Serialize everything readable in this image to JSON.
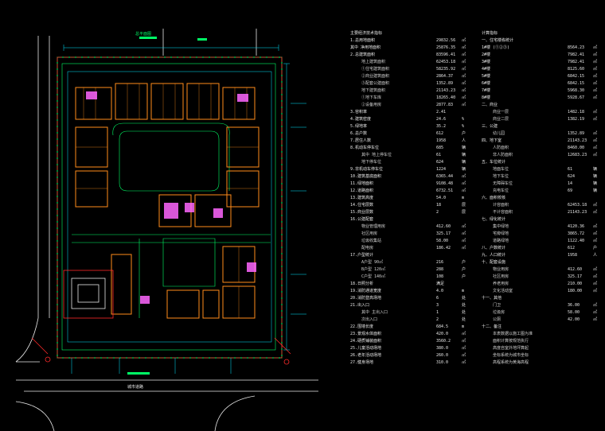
{
  "drawing": {
    "site_title": "总平面图",
    "road_label": "城市道路"
  },
  "tables": {
    "left": [
      {
        "label": "主要经济技术指标",
        "value": "",
        "unit": ""
      },
      {
        "label": "1.总用地面积",
        "value": "29832.56",
        "unit": "㎡"
      },
      {
        "label": "其中 净用地面积",
        "value": "25876.35",
        "unit": "㎡"
      },
      {
        "label": "2.总建筑面积",
        "value": "83596.41",
        "unit": "㎡"
      },
      {
        "label": "地上建筑面积",
        "value": "62453.18",
        "unit": "㎡",
        "sub": true
      },
      {
        "label": "①住宅建筑面积",
        "value": "58235.92",
        "unit": "㎡",
        "sub": true
      },
      {
        "label": "②商业建筑面积",
        "value": "2864.37",
        "unit": "㎡",
        "sub": true
      },
      {
        "label": "③配套公建面积",
        "value": "1352.89",
        "unit": "㎡",
        "sub": true
      },
      {
        "label": "地下建筑面积",
        "value": "21143.23",
        "unit": "㎡",
        "sub": true
      },
      {
        "label": "①地下车库",
        "value": "18265.40",
        "unit": "㎡",
        "sub": true
      },
      {
        "label": "②设备用房",
        "value": "2877.83",
        "unit": "㎡",
        "sub": true
      },
      {
        "label": "3.容积率",
        "value": "2.41",
        "unit": ""
      },
      {
        "label": "4.建筑密度",
        "value": "24.6",
        "unit": "%"
      },
      {
        "label": "5.绿地率",
        "value": "35.2",
        "unit": "%"
      },
      {
        "label": "6.总户数",
        "value": "612",
        "unit": "户"
      },
      {
        "label": "7.居住人数",
        "value": "1958",
        "unit": "人"
      },
      {
        "label": "8.机动车停车位",
        "value": "685",
        "unit": "辆"
      },
      {
        "label": "其中 地上停车位",
        "value": "61",
        "unit": "辆",
        "sub": true
      },
      {
        "label": "地下停车位",
        "value": "624",
        "unit": "辆",
        "sub": true
      },
      {
        "label": "9.非机动车停车位",
        "value": "1224",
        "unit": "辆"
      },
      {
        "label": "10.建筑基底面积",
        "value": "6365.44",
        "unit": "㎡"
      },
      {
        "label": "11.绿地面积",
        "value": "9108.48",
        "unit": "㎡"
      },
      {
        "label": "12.道路面积",
        "value": "6732.51",
        "unit": "㎡"
      },
      {
        "label": "13.建筑高度",
        "value": "54.0",
        "unit": "m"
      },
      {
        "label": "14.住宅层数",
        "value": "18",
        "unit": "层"
      },
      {
        "label": "15.商业层数",
        "value": "2",
        "unit": "层"
      },
      {
        "label": "16.公建配套",
        "value": "",
        "unit": ""
      },
      {
        "label": "物业管理用房",
        "value": "412.60",
        "unit": "㎡",
        "sub": true
      },
      {
        "label": "社区用房",
        "value": "325.17",
        "unit": "㎡",
        "sub": true
      },
      {
        "label": "垃圾收集站",
        "value": "58.00",
        "unit": "㎡",
        "sub": true
      },
      {
        "label": "配电房",
        "value": "186.42",
        "unit": "㎡",
        "sub": true
      },
      {
        "label": "17.户型统计",
        "value": "",
        "unit": ""
      },
      {
        "label": "A户型 90㎡",
        "value": "216",
        "unit": "户",
        "sub": true
      },
      {
        "label": "B户型 120㎡",
        "value": "288",
        "unit": "户",
        "sub": true
      },
      {
        "label": "C户型 140㎡",
        "value": "108",
        "unit": "户",
        "sub": true
      },
      {
        "label": "18.日照分析",
        "value": "满足",
        "unit": ""
      },
      {
        "label": "19.消防通道宽度",
        "value": "4.0",
        "unit": "m"
      },
      {
        "label": "20.消防登高场地",
        "value": "6",
        "unit": "处"
      },
      {
        "label": "21.出入口",
        "value": "3",
        "unit": "处"
      },
      {
        "label": "其中 主出入口",
        "value": "1",
        "unit": "处",
        "sub": true
      },
      {
        "label": "次出入口",
        "value": "2",
        "unit": "处",
        "sub": true
      },
      {
        "label": "22.围墙长度",
        "value": "684.5",
        "unit": "m"
      },
      {
        "label": "23.景观水体面积",
        "value": "420.0",
        "unit": "㎡"
      },
      {
        "label": "24.硬质铺装面积",
        "value": "3560.2",
        "unit": "㎡"
      },
      {
        "label": "25.儿童活动场地",
        "value": "380.0",
        "unit": "㎡"
      },
      {
        "label": "26.老年活动场地",
        "value": "260.0",
        "unit": "㎡"
      },
      {
        "label": "27.健身场地",
        "value": "310.0",
        "unit": "㎡"
      }
    ],
    "right": [
      {
        "label": "计算指标",
        "value": "",
        "unit": ""
      },
      {
        "label": "一、住宅楼栋统计",
        "value": "",
        "unit": ""
      },
      {
        "label": "1#楼 (①②③)",
        "value": "8564.23",
        "unit": "㎡"
      },
      {
        "label": "2#楼",
        "value": "7982.41",
        "unit": "㎡"
      },
      {
        "label": "3#楼",
        "value": "7982.41",
        "unit": "㎡"
      },
      {
        "label": "4#楼",
        "value": "8125.60",
        "unit": "㎡"
      },
      {
        "label": "5#楼",
        "value": "6842.15",
        "unit": "㎡"
      },
      {
        "label": "6#楼",
        "value": "6842.15",
        "unit": "㎡"
      },
      {
        "label": "7#楼",
        "value": "5968.30",
        "unit": "㎡"
      },
      {
        "label": "8#楼",
        "value": "5928.67",
        "unit": "㎡"
      },
      {
        "label": "二、商业",
        "value": "",
        "unit": ""
      },
      {
        "label": "商业一层",
        "value": "1482.18",
        "unit": "㎡",
        "sub": true
      },
      {
        "label": "商业二层",
        "value": "1382.19",
        "unit": "㎡",
        "sub": true
      },
      {
        "label": "三、公建",
        "value": "",
        "unit": ""
      },
      {
        "label": "幼儿园",
        "value": "1352.89",
        "unit": "㎡",
        "sub": true
      },
      {
        "label": "四、地下室",
        "value": "21143.23",
        "unit": "㎡"
      },
      {
        "label": "人防面积",
        "value": "8460.00",
        "unit": "㎡",
        "sub": true
      },
      {
        "label": "非人防面积",
        "value": "12683.23",
        "unit": "㎡",
        "sub": true
      },
      {
        "label": "五、车位统计",
        "value": "",
        "unit": ""
      },
      {
        "label": "地面车位",
        "value": "61",
        "unit": "辆",
        "sub": true
      },
      {
        "label": "地下车位",
        "value": "624",
        "unit": "辆",
        "sub": true
      },
      {
        "label": "无障碍车位",
        "value": "14",
        "unit": "辆",
        "sub": true
      },
      {
        "label": "充电车位",
        "value": "69",
        "unit": "辆",
        "sub": true
      },
      {
        "label": "六、面积校核",
        "value": "",
        "unit": ""
      },
      {
        "label": "计容面积",
        "value": "62453.18",
        "unit": "㎡",
        "sub": true
      },
      {
        "label": "不计容面积",
        "value": "21143.23",
        "unit": "㎡",
        "sub": true
      },
      {
        "label": "七、绿化统计",
        "value": "",
        "unit": ""
      },
      {
        "label": "集中绿地",
        "value": "4120.36",
        "unit": "㎡",
        "sub": true
      },
      {
        "label": "宅旁绿地",
        "value": "3865.72",
        "unit": "㎡",
        "sub": true
      },
      {
        "label": "道路绿地",
        "value": "1122.40",
        "unit": "㎡",
        "sub": true
      },
      {
        "label": "八、户数统计",
        "value": "612",
        "unit": "户"
      },
      {
        "label": "九、人口统计",
        "value": "1958",
        "unit": "人"
      },
      {
        "label": "十、配套设施",
        "value": "",
        "unit": ""
      },
      {
        "label": "物业用房",
        "value": "412.60",
        "unit": "㎡",
        "sub": true
      },
      {
        "label": "社区用房",
        "value": "325.17",
        "unit": "㎡",
        "sub": true
      },
      {
        "label": "养老用房",
        "value": "210.00",
        "unit": "㎡",
        "sub": true
      },
      {
        "label": "文化活动室",
        "value": "180.00",
        "unit": "㎡",
        "sub": true
      },
      {
        "label": "十一、其他",
        "value": "",
        "unit": ""
      },
      {
        "label": "门卫",
        "value": "36.00",
        "unit": "㎡",
        "sub": true
      },
      {
        "label": "垃圾房",
        "value": "58.00",
        "unit": "㎡",
        "sub": true
      },
      {
        "label": "公厕",
        "value": "42.00",
        "unit": "㎡",
        "sub": true
      },
      {
        "label": "十二、备注",
        "value": "",
        "unit": ""
      },
      {
        "label": "本表数据以施工图为准",
        "value": "",
        "unit": "",
        "sub": true
      },
      {
        "label": "面积计算按规范执行",
        "value": "",
        "unit": "",
        "sub": true
      },
      {
        "label": "高度自室外地坪算起",
        "value": "",
        "unit": "",
        "sub": true
      },
      {
        "label": "坐标系统为城市坐标",
        "value": "",
        "unit": "",
        "sub": true
      },
      {
        "label": "高程系统为黄海高程",
        "value": "",
        "unit": "",
        "sub": true
      }
    ]
  },
  "colors": {
    "background": "#000000",
    "boundary": "#00ff66",
    "building": "#ff8c1a",
    "road": "#e8e8e8",
    "dimension": "#00e5ff",
    "highlight": "#ff66ff",
    "redline": "#ff2a2a"
  }
}
